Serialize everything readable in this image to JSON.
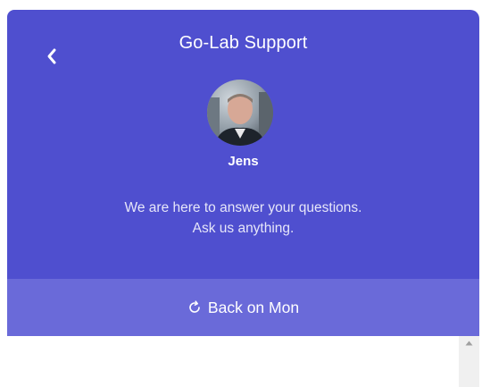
{
  "header": {
    "title": "Go-Lab Support",
    "back_icon": "chevron-left-icon",
    "agent": {
      "name": "Jens",
      "avatar": "avatar-photo"
    },
    "welcome_lines": [
      "We are here to answer your questions.",
      "Ask us anything."
    ]
  },
  "status": {
    "icon": "reload-icon",
    "text": "Back on Mon"
  },
  "scrollbar": {
    "up_icon": "scroll-up-arrow-icon"
  },
  "colors": {
    "header_bg": "#4f4fcf",
    "status_bg": "#6a6ad9",
    "text": "#ffffff"
  }
}
